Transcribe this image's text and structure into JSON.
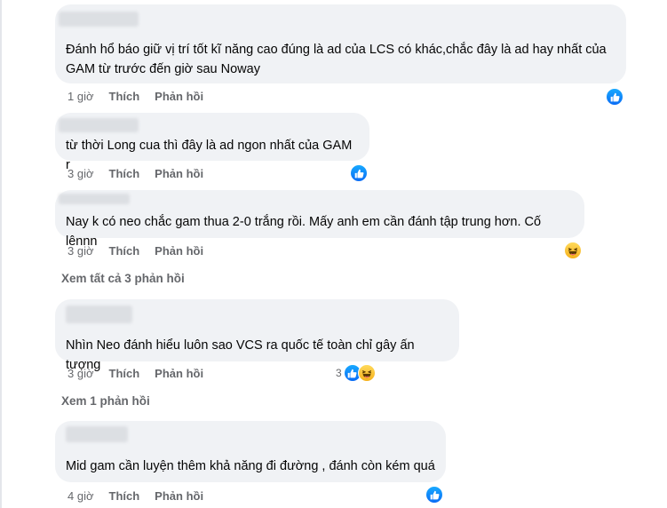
{
  "comments": [
    {
      "text": "Đánh hổ báo giữ vị trí tốt kĩ năng cao đúng là ad của LCS có khác,chắc đây là ad hay nhất của GAM từ trước đến giờ sau Noway",
      "time": "1 giờ",
      "like_label": "Thích",
      "reply_label": "Phản hồi",
      "reactions": [
        "like-icon"
      ],
      "reaction_count": ""
    },
    {
      "text": "từ thời Long cua thì đây là ad ngon nhất của GAM r",
      "time": "3 giờ",
      "like_label": "Thích",
      "reply_label": "Phản hồi",
      "reactions": [
        "like-icon"
      ],
      "reaction_count": ""
    },
    {
      "text": "Nay k có neo chắc gam thua 2-0 trắng rồi. Mấy anh em cần đánh tập trung hơn. Cố lênnn",
      "time": "3 giờ",
      "like_label": "Thích",
      "reply_label": "Phản hồi",
      "reactions": [
        "haha-icon"
      ],
      "reaction_count": "",
      "view_replies": "Xem tất cả 3 phản hồi"
    },
    {
      "text": "Nhìn Neo đánh hiểu luôn sao VCS ra quốc tế toàn chỉ gây ấn tượng",
      "time": "3 giờ",
      "like_label": "Thích",
      "reply_label": "Phản hồi",
      "reactions": [
        "like-icon",
        "haha-icon"
      ],
      "reaction_count": "3",
      "view_replies": "Xem 1 phản hồi"
    },
    {
      "text": "Mid gam cần luyện thêm khả năng đi đường , đánh còn kém quá",
      "time": "4 giờ",
      "like_label": "Thích",
      "reply_label": "Phản hồi",
      "reactions": [
        "like-icon"
      ],
      "reaction_count": ""
    }
  ],
  "colors": {
    "bubble": "#f0f2f5",
    "meta": "#65676b",
    "like": "#1877f2",
    "haha": "#f7b125"
  }
}
